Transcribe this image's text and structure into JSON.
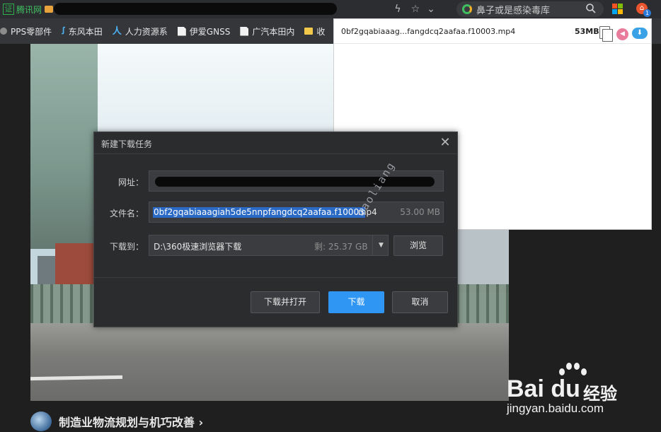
{
  "browser": {
    "site_badge": "证",
    "site_name": "腾讯网",
    "search_placeholder": "鼻子或是感染毒库",
    "extension_count": "1"
  },
  "bookmarks": [
    {
      "label": "PPS零部件",
      "icon": "dot-icon"
    },
    {
      "label": "东风本田",
      "icon": "brand-icon"
    },
    {
      "label": "人力资源系",
      "icon": "brand-icon"
    },
    {
      "label": "伊爱GNSS",
      "icon": "doc-icon"
    },
    {
      "label": "广汽本田内",
      "icon": "doc-icon"
    },
    {
      "label": "收",
      "icon": "folder-icon"
    }
  ],
  "download_list": {
    "file_name": "0bf2gqabiaaag...fangdcq2aafaa.f10003.mp4",
    "size": "53MB"
  },
  "modal": {
    "title": "新建下载任务",
    "url_label": "网址：",
    "name_label": "文件名：",
    "file_name_selected": "0bf2gqabiaaagiah5de5nnpfangdcq2aafaa.f10003",
    "file_ext": ".mp4",
    "file_size": "53.00 MB",
    "save_to_label": "下载到：",
    "save_path": "D:\\360极速浏览器下载",
    "free_space": "剩: 25.37 GB",
    "browse_label": "浏览",
    "open_after_label": "下载并打开",
    "download_label": "下载",
    "cancel_label": "取消"
  },
  "watermark_text": "caoliang",
  "article": {
    "title": "制造业物流规划与机巧改善 ›"
  },
  "baidu_watermark": {
    "brand": "Bai du",
    "suffix": "经验",
    "url": "jingyan.baidu.com"
  },
  "colors": {
    "primary_button": "#2f97f3",
    "selection": "#2a6ac4",
    "dialog_bg": "#2b2c2e"
  }
}
